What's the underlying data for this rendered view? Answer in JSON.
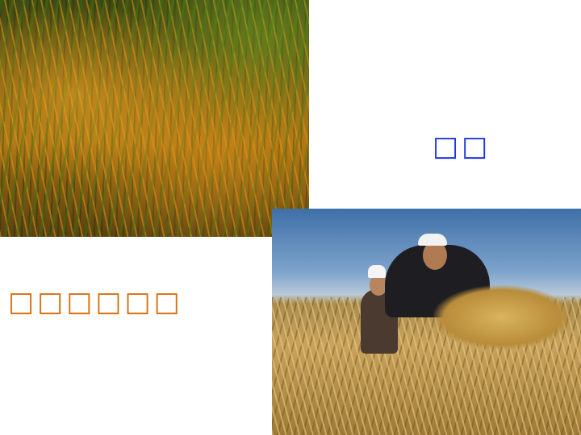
{
  "slide": {
    "images": {
      "rice_field": "rice-paddy-photo",
      "farmers": "farmers-harvesting-photo"
    },
    "labels": {
      "rice": "□□",
      "harvest": "□□□□□□"
    },
    "colors": {
      "rice_label": "#1f35e0",
      "harvest_label": "#d8700f",
      "background": "#ffffff"
    }
  }
}
